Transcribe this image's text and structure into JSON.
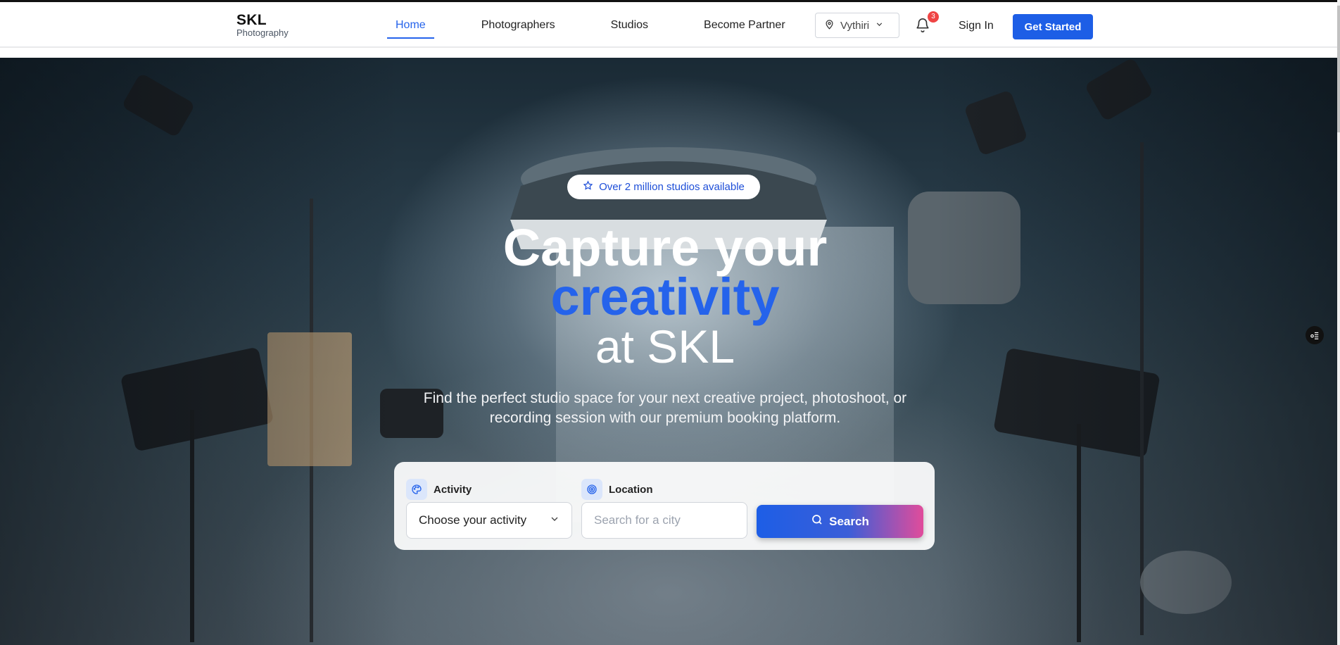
{
  "brand": {
    "name": "SKL",
    "tagline": "Photography"
  },
  "nav": {
    "items": [
      {
        "label": "Home",
        "active": true
      },
      {
        "label": "Photographers",
        "active": false
      },
      {
        "label": "Studios",
        "active": false
      },
      {
        "label": "Become Partner",
        "active": false
      }
    ],
    "location": "Vythiri",
    "notification_count": "3",
    "sign_in": "Sign In",
    "cta": "Get Started"
  },
  "hero": {
    "badge": "Over 2 million studios available",
    "title_line1": "Capture your",
    "title_line2": "creativity",
    "title_line3": "at SKL",
    "subtitle": "Find the perfect studio space for your next creative project, photoshoot, or recording session with our premium booking platform."
  },
  "search": {
    "activity_label": "Activity",
    "activity_value": "Choose your activity",
    "location_label": "Location",
    "location_placeholder": "Search for a city",
    "button_label": "Search"
  },
  "colors": {
    "accent": "#2563eb",
    "cta": "#1d5ee6",
    "badge": "#ef4444",
    "gradient_end": "#e14c9b"
  }
}
